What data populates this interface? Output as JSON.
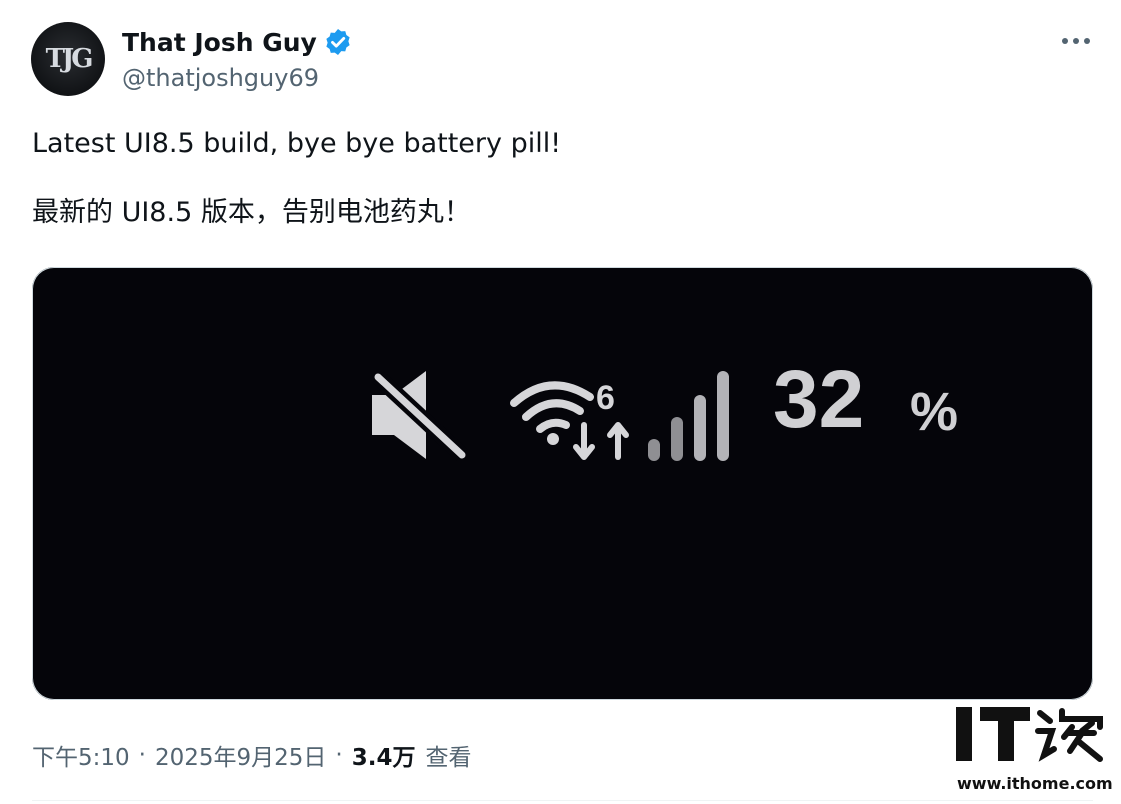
{
  "author": {
    "name": "That Josh Guy",
    "handle": "@thatjoshguy69",
    "avatar_monogram": "TJG",
    "verified_color": "#1d9bf0"
  },
  "tweet": {
    "text_en": "Latest UI8.5 build, bye bye battery pill!",
    "text_zh": "最新的 UI8.5 版本，告别电池药丸！"
  },
  "media": {
    "status_bar": {
      "icons": [
        "mute-icon",
        "wifi-6-icon",
        "signal-bars-icon"
      ],
      "wifi_badge": "6",
      "battery_value": "32",
      "battery_unit": "%"
    }
  },
  "meta": {
    "time": "下午5:10",
    "date": "2025年9月25日",
    "separator": "·",
    "views_count": "3.4万",
    "views_label": "查看"
  },
  "watermark": {
    "url": "www.ithome.com",
    "logo_text": "IT之家"
  }
}
